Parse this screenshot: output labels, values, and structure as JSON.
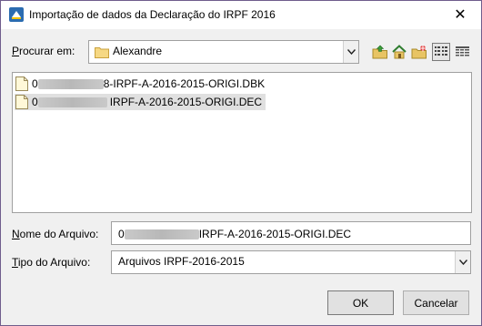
{
  "window": {
    "title": "Importação de dados da Declaração do IRPF 2016",
    "close_glyph": "✕"
  },
  "look_in": {
    "label_u": "P",
    "label_rest": "rocurar em:",
    "value": "Alexandre"
  },
  "toolbar": {
    "icons": [
      "up-folder-icon",
      "home-icon",
      "new-folder-icon",
      "list-view-icon",
      "details-view-icon"
    ],
    "active_view": "list"
  },
  "files": [
    {
      "prefix": "0",
      "name": "8-IRPF-A-2016-2015-ORIGI.DBK",
      "selected": false
    },
    {
      "prefix": "0",
      "name": "IRPF-A-2016-2015-ORIGI.DEC",
      "selected": true
    }
  ],
  "filename": {
    "label_u": "N",
    "label_rest": "ome do Arquivo:",
    "value_prefix": "0",
    "value": "IRPF-A-2016-2015-ORIGI.DEC"
  },
  "filetype": {
    "label_u": "T",
    "label_rest": "ipo do Arquivo:",
    "value": "Arquivos IRPF-2016-2015"
  },
  "buttons": {
    "ok": "OK",
    "cancel": "Cancelar"
  },
  "colors": {
    "border": "#6f5d8c",
    "folder": "#e8c463",
    "selected_bg": "#e0e0e0"
  }
}
